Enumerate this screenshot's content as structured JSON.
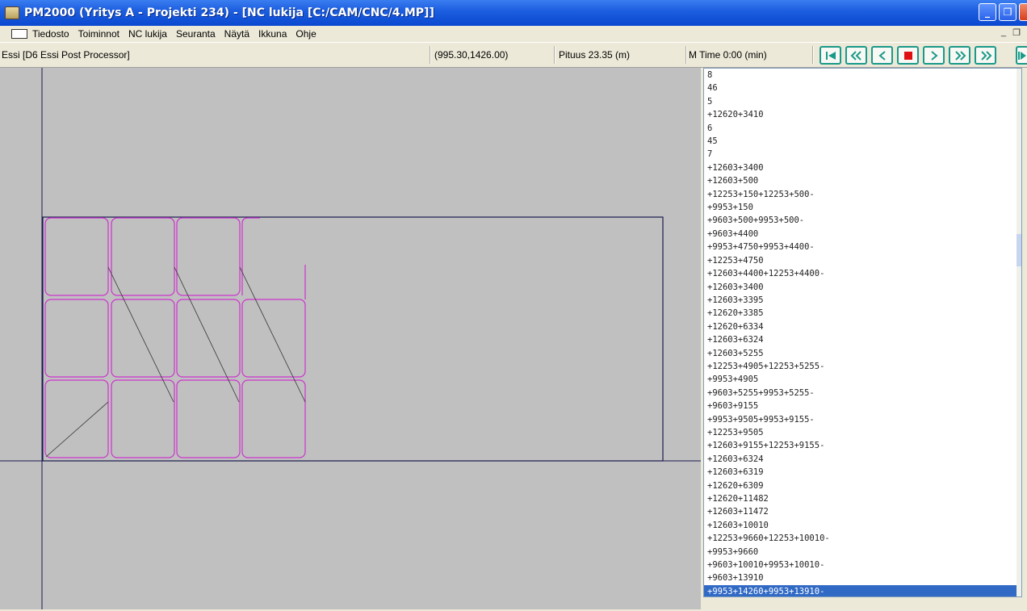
{
  "window": {
    "title": "PM2000 (Yritys A - Projekti 234) - [NC lukija [C:/CAM/CNC/4.MP]]",
    "buttons": [
      "minimize-icon",
      "restore-icon",
      "close-icon"
    ]
  },
  "menu": {
    "items": [
      "Tiedosto",
      "Toiminnot",
      "NC lukija",
      "Seuranta",
      "Näytä",
      "Ikkuna",
      "Ohje"
    ],
    "mdi_min": "_",
    "mdi_restore": "❐"
  },
  "status": {
    "processor": "Essi [D6 Essi Post Processor]",
    "coords": "(995.30,1426.00)",
    "length": "Pituus 23.35 (m)",
    "time": "M Time 0:00 (min)"
  },
  "nav_buttons": [
    "skip-first-icon",
    "fast-back-icon",
    "step-back-icon",
    "stop-icon",
    "step-forward-icon",
    "fast-forward-icon",
    "play-icon"
  ],
  "colors": {
    "accent_teal": "#1a9a8a",
    "stop_red": "#e01010",
    "part_outline": "#cc33cc",
    "plate_outline": "#1a1a50",
    "selection": "#316ac5"
  },
  "nc_code": {
    "lines": [
      "8",
      "46",
      "5",
      "+12620+3410",
      "6",
      "45",
      "7",
      "+12603+3400",
      "+12603+500",
      "+12253+150+12253+500-",
      "+9953+150",
      "+9603+500+9953+500-",
      "+9603+4400",
      "+9953+4750+9953+4400-",
      "+12253+4750",
      "+12603+4400+12253+4400-",
      "+12603+3400",
      "+12603+3395",
      "+12620+3385",
      "+12620+6334",
      "+12603+6324",
      "+12603+5255",
      "+12253+4905+12253+5255-",
      "+9953+4905",
      "+9603+5255+9953+5255-",
      "+9603+9155",
      "+9953+9505+9953+9155-",
      "+12253+9505",
      "+12603+9155+12253+9155-",
      "+12603+6324",
      "+12603+6319",
      "+12620+6309",
      "+12620+11482",
      "+12603+11472",
      "+12603+10010",
      "+12253+9660+12253+10010-",
      "+9953+9660",
      "+9603+10010+9953+10010-",
      "+9603+13910",
      "+9953+14260+9953+13910-"
    ],
    "selected_index": 39
  }
}
